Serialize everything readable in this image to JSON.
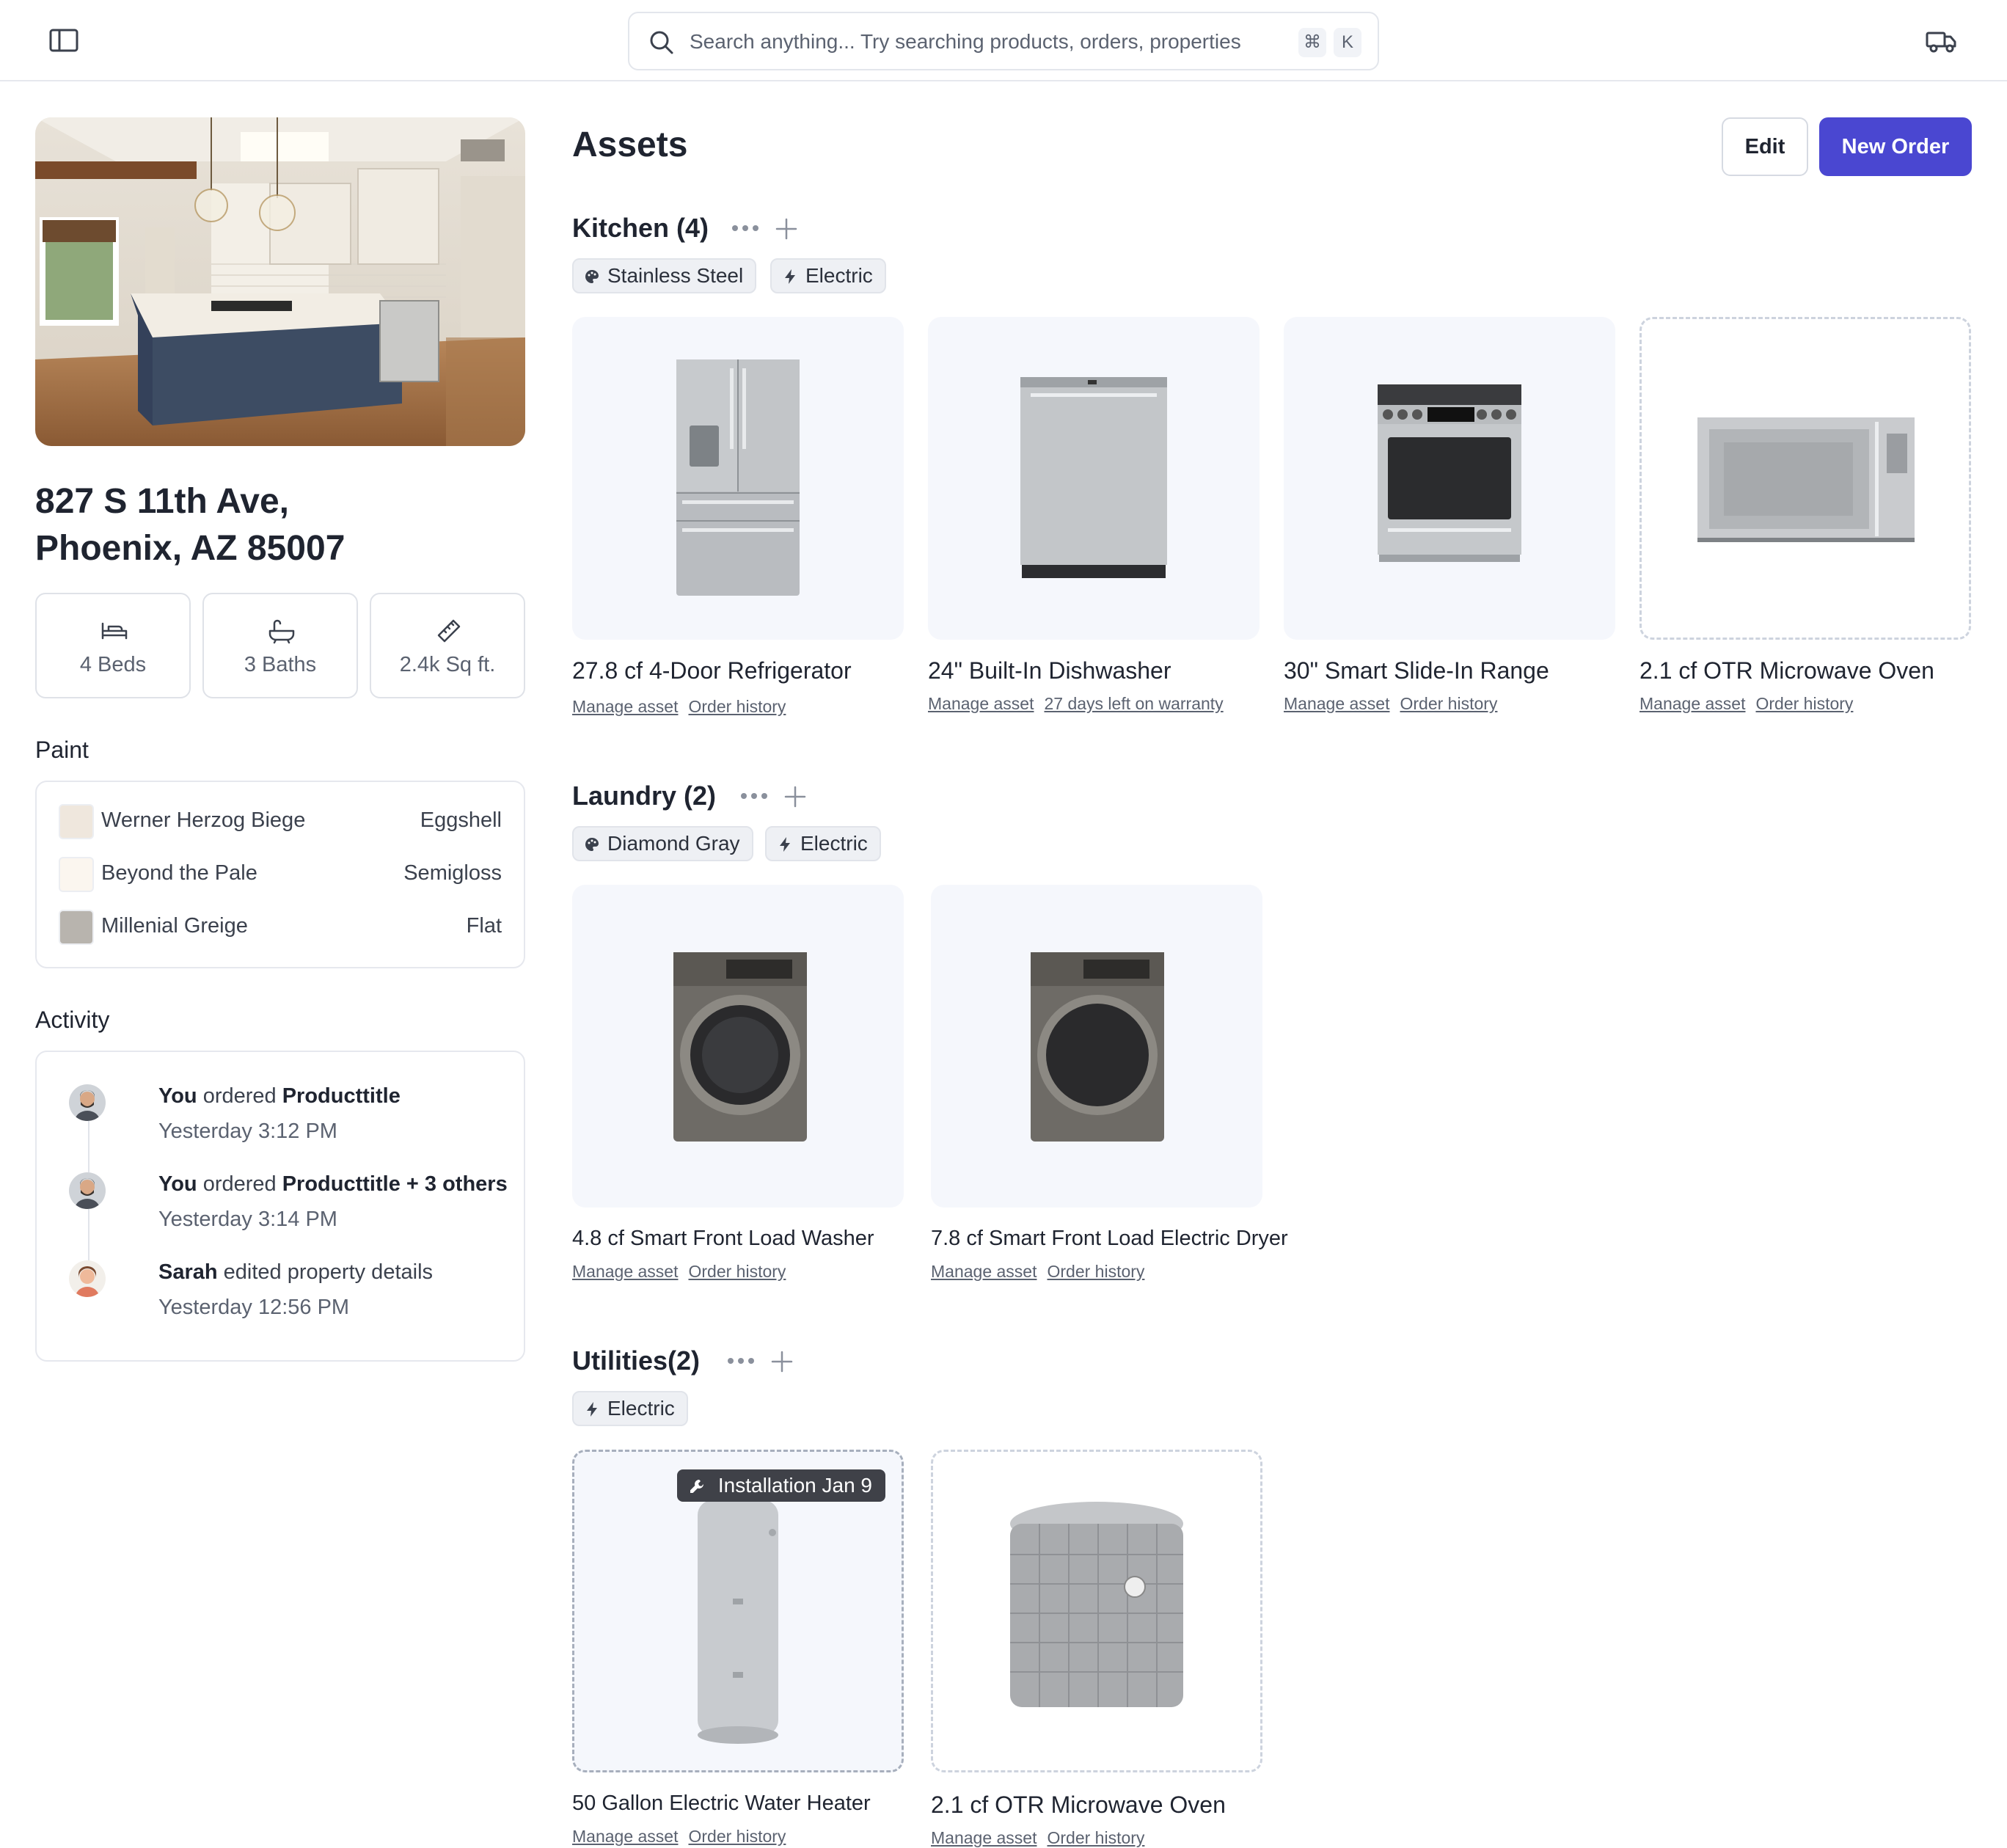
{
  "header": {
    "search_placeholder": "Search anything... Try searching products, orders, properties",
    "shortcut_keys": [
      "⌘",
      "K"
    ],
    "icons": [
      "sidebar-toggle-icon",
      "search-icon",
      "truck-icon"
    ]
  },
  "property": {
    "address_line1": "827 S 11th Ave,",
    "address_line2": "Phoenix, AZ 85007",
    "stats": [
      {
        "icon": "bed-icon",
        "label": "4 Beds"
      },
      {
        "icon": "bath-icon",
        "label": "3 Baths"
      },
      {
        "icon": "ruler-icon",
        "label": "2.4k Sq ft."
      }
    ]
  },
  "paint": {
    "heading": "Paint",
    "items": [
      {
        "name": "Werner Herzog Biege",
        "finish": "Eggshell",
        "color": "#efe7dd"
      },
      {
        "name": "Beyond the Pale",
        "finish": "Semigloss",
        "color": "#fbf6ef"
      },
      {
        "name": "Millenial Greige",
        "finish": "Flat",
        "color": "#b8b4ae"
      }
    ]
  },
  "activity": {
    "heading": "Activity",
    "items": [
      {
        "actor": "You",
        "verb": "ordered",
        "object": "Producttitle",
        "time": "Yesterday 3:12 PM"
      },
      {
        "actor": "You",
        "verb": "ordered",
        "object": "Producttitle + 3 others",
        "time": "Yesterday 3:14 PM"
      },
      {
        "actor": "Sarah",
        "verb": "edited property details",
        "object": "",
        "time": "Yesterday 12:56 PM"
      }
    ]
  },
  "main": {
    "title": "Assets",
    "edit_label": "Edit",
    "new_order_label": "New Order",
    "brand_color": "#4a47d1"
  },
  "sections": [
    {
      "title": "Kitchen (4)",
      "tags": [
        {
          "icon": "palette-icon",
          "label": "Stainless Steel"
        },
        {
          "icon": "bolt-icon",
          "label": "Electric"
        }
      ],
      "items": [
        {
          "name": "27.8 cf 4-Door Refrigerator",
          "links": [
            "Manage asset",
            "Order history"
          ]
        },
        {
          "name": "24\" Built-In Dishwasher",
          "links": [
            "Manage asset",
            "27 days left on warranty"
          ]
        },
        {
          "name": "30\" Smart Slide-In Range",
          "links": [
            "Manage asset",
            "Order history"
          ]
        },
        {
          "name": "2.1 cf OTR Microwave Oven",
          "links": [
            "Manage asset",
            "Order history"
          ]
        }
      ]
    },
    {
      "title": "Laundry (2)",
      "tags": [
        {
          "icon": "palette-icon",
          "label": "Diamond Gray"
        },
        {
          "icon": "bolt-icon",
          "label": "Electric"
        }
      ],
      "items": [
        {
          "name": "4.8 cf Smart Front Load Washer",
          "links": [
            "Manage asset",
            "Order history"
          ]
        },
        {
          "name": "7.8 cf Smart Front Load Electric Dryer",
          "links": [
            "Manage asset",
            "Order history"
          ]
        }
      ]
    },
    {
      "title": "Utilities(2)",
      "tags": [
        {
          "icon": "bolt-icon",
          "label": "Electric"
        }
      ],
      "items": [
        {
          "name": "50 Gallon Electric Water Heater",
          "links": [
            "Manage asset",
            "Order history"
          ],
          "badge": "Installation Jan 9"
        },
        {
          "name": "2.1 cf OTR Microwave Oven",
          "links": [
            "Manage asset",
            "Order history"
          ]
        }
      ]
    }
  ]
}
